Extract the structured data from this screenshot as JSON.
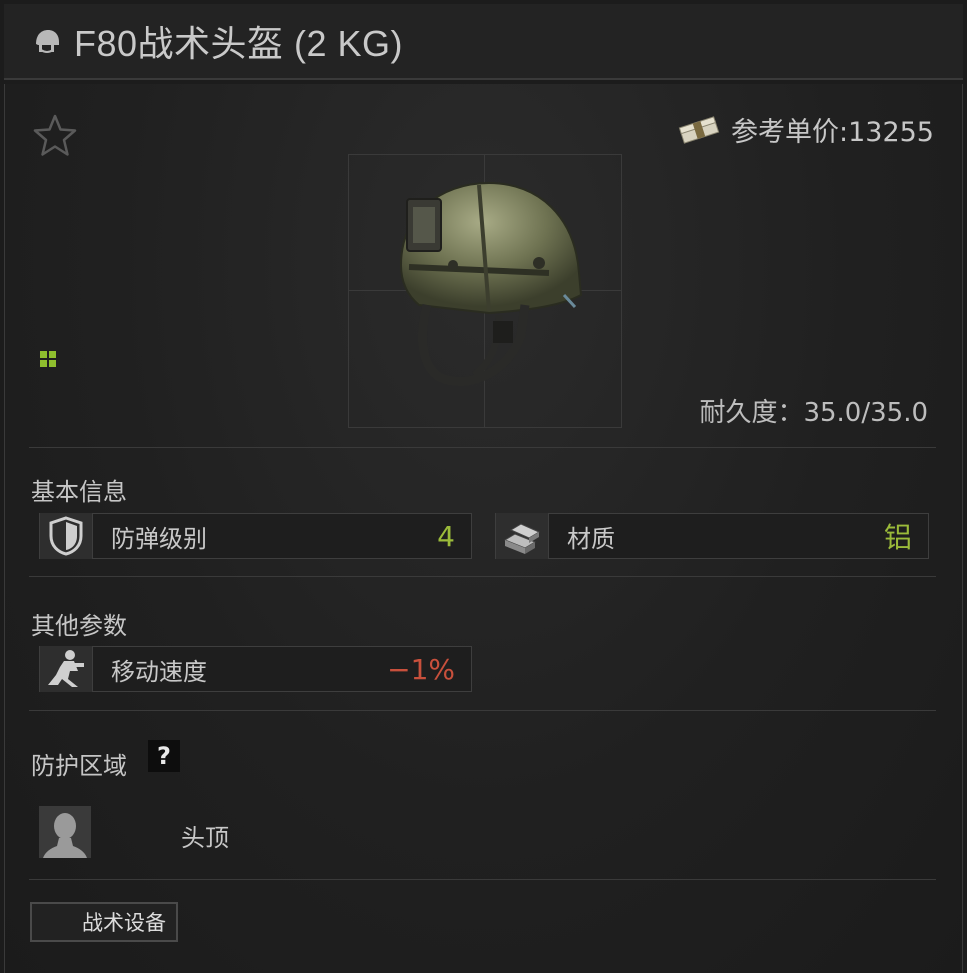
{
  "window": {
    "title": "F80战术头盔 (2 KG)",
    "title_icon": "helmet-icon"
  },
  "header": {
    "favorite_icon": "star-icon",
    "price_icon": "money-stack-icon",
    "price_label": "参考单价:13255"
  },
  "item": {
    "image": "tactical-helmet",
    "size_icon": "grid-size-icon",
    "durability": "耐久度：35.0/35.0"
  },
  "basic_info": {
    "title": "基本信息",
    "stats": [
      {
        "icon": "shield-icon",
        "label": "防弹级别",
        "value": "4",
        "color": "#9bbb3a"
      },
      {
        "icon": "material-bars-icon",
        "label": "材质",
        "value": "铝",
        "color": "#9bbb3a"
      }
    ]
  },
  "other_params": {
    "title": "其他参数",
    "stats": [
      {
        "icon": "running-soldier-icon",
        "label": "移动速度",
        "value": "−1%",
        "color": "#c8503c"
      }
    ]
  },
  "protection": {
    "title": "防护区域",
    "help": "?",
    "zones": [
      {
        "icon": "head-silhouette-icon",
        "label": "头顶"
      }
    ]
  },
  "tags": [
    {
      "label": "战术设备"
    }
  ]
}
